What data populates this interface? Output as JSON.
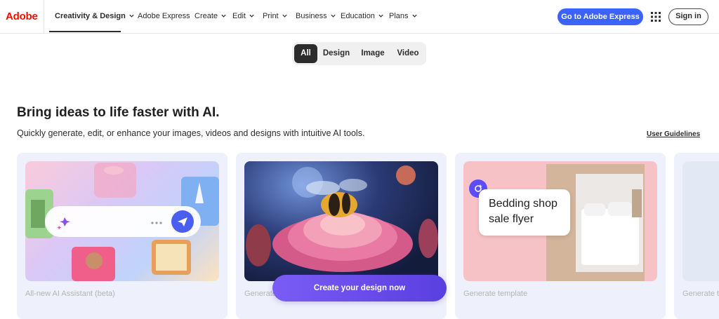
{
  "nav": {
    "logo": "Adobe",
    "items": [
      {
        "label": "Creativity & Design",
        "dropdown": true
      },
      {
        "label": "Adobe Express",
        "dropdown": false
      },
      {
        "label": "Create",
        "dropdown": true
      },
      {
        "label": "Edit",
        "dropdown": true
      },
      {
        "label": "Print",
        "dropdown": true
      },
      {
        "label": "Business",
        "dropdown": true
      },
      {
        "label": "Education",
        "dropdown": true
      },
      {
        "label": "Plans",
        "dropdown": true
      }
    ],
    "cta": "Go to Adobe Express",
    "sign_in": "Sign in",
    "apps_icon": "apps-grid-icon"
  },
  "filters": {
    "tabs": [
      "All",
      "Design",
      "Image",
      "Video"
    ],
    "active": "All"
  },
  "hero": {
    "title": "Bring ideas to life faster with AI.",
    "subtitle": "Quickly generate, edit, or enhance your images, videos and designs with intuitive AI tools.",
    "guidelines": "User Guidelines"
  },
  "cards": [
    {
      "caption": "All-new AI Assistant (beta)"
    },
    {
      "caption": "Generate image"
    },
    {
      "caption": "Generate template",
      "flyer_text": "Bedding shop\nsale flyer"
    },
    {
      "caption": "Generate t"
    }
  ],
  "create_button": "Create your design now",
  "colors": {
    "brand_red": "#eb1000",
    "primary_blue": "#3b63fb",
    "purple": "#5a3fe0"
  }
}
